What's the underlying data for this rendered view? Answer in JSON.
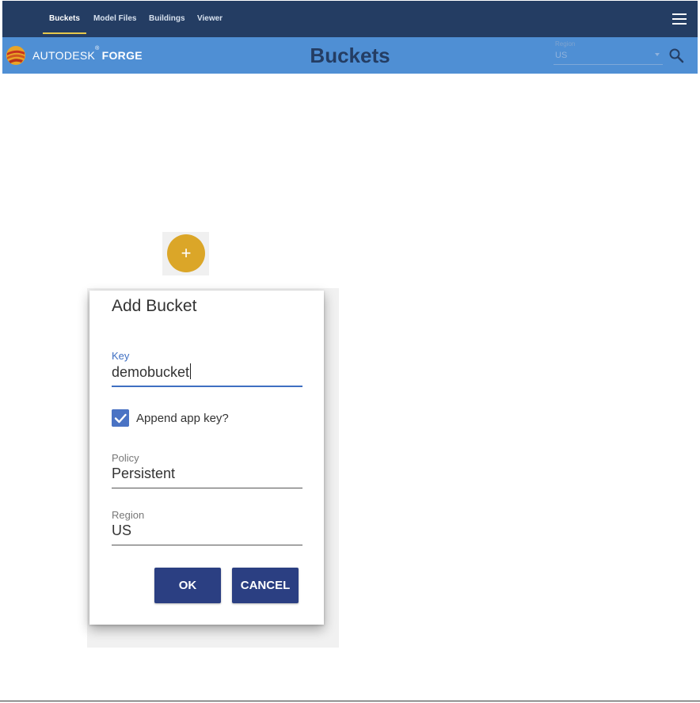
{
  "nav": {
    "tabs": [
      {
        "label": "Buckets",
        "active": true
      },
      {
        "label": "Model Files",
        "active": false
      },
      {
        "label": "Buildings",
        "active": false
      },
      {
        "label": "Viewer",
        "active": false
      }
    ],
    "menu_icon": "hamburger-icon"
  },
  "header": {
    "brand_prefix": "AUTODESK",
    "brand_suffix": "FORGE",
    "title": "Buckets",
    "region_label": "Region",
    "region_value": "US",
    "search_icon": "search-icon"
  },
  "fab": {
    "label": "+",
    "color": "#dba628"
  },
  "dialog": {
    "title": "Add Bucket",
    "key": {
      "label": "Key",
      "value": "demobucket"
    },
    "append": {
      "label": "Append app key?",
      "checked": true
    },
    "policy": {
      "label": "Policy",
      "value": "Persistent"
    },
    "region": {
      "label": "Region",
      "value": "US"
    },
    "ok_label": "OK",
    "cancel_label": "CANCEL"
  },
  "colors": {
    "nav_bg": "#243d63",
    "header_bg": "#4f8fd4",
    "button_bg": "#2b3f82",
    "accent": "#3f6fc2"
  }
}
